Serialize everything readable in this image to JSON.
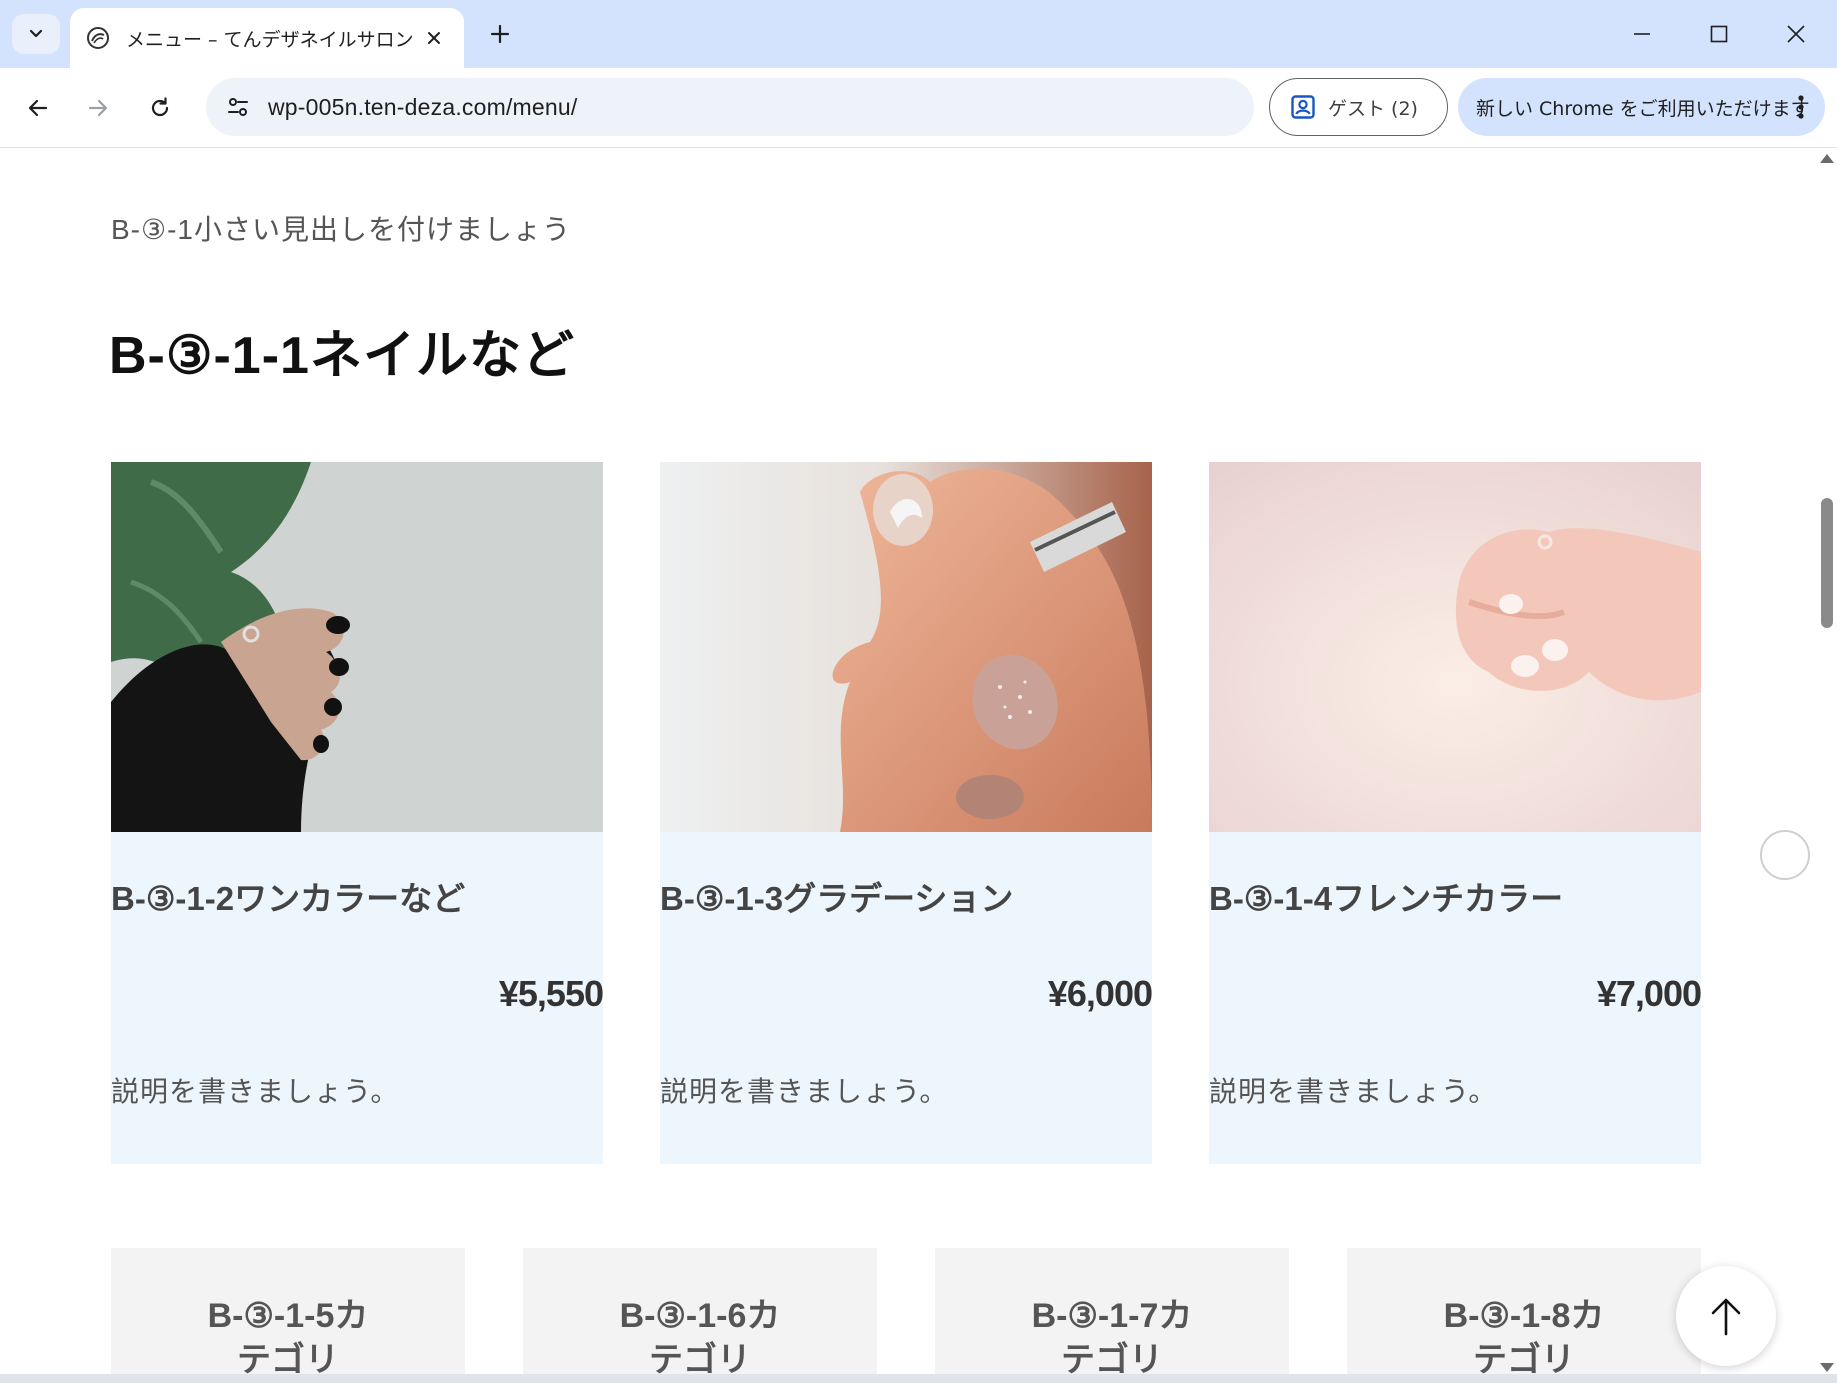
{
  "browser": {
    "tab": {
      "title": "メニュー – てんデザネイルサロン",
      "icon": "salon-favicon-icon"
    },
    "url": "wp-005n.ten-deza.com/menu/",
    "profile": {
      "label": "ゲスト (2)",
      "icon": "person-badge-icon"
    },
    "update": {
      "label": "新しい Chrome をご利用いただけます",
      "icon": "kebab-menu-icon"
    },
    "colors": {
      "frame": "#d3e3fd",
      "omnibox": "#eef2f9"
    }
  },
  "page": {
    "sub_heading": "B-③-1小さい見出しを付けましょう",
    "heading": "B-③-1-1ネイルなど",
    "cards": [
      {
        "name": "B-③-1-2ワンカラーなど",
        "price": "¥5,550",
        "description": "説明を書きましょう。"
      },
      {
        "name": "B-③-1-3グラデーション",
        "price": "¥6,000",
        "description": "説明を書きましょう。"
      },
      {
        "name": "B-③-1-4フレンチカラー",
        "price": "¥7,000",
        "description": "説明を書きましょう。"
      }
    ],
    "categories": [
      {
        "label": "B-③-1-5カテゴリ"
      },
      {
        "label": "B-③-1-6カテゴリ"
      },
      {
        "label": "B-③-1-7カテゴリ"
      },
      {
        "label": "B-③-1-8カテゴリ"
      }
    ],
    "back_to_top_icon": "arrow-up-icon",
    "colors": {
      "card_bg": "#eef6fd",
      "category_bg": "#f3f3f3"
    }
  }
}
